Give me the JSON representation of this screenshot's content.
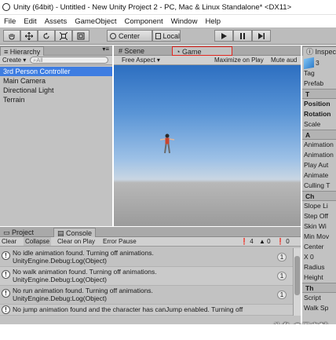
{
  "window": {
    "title": "Unity (64bit) - Untitled - New Unity Project 2 - PC, Mac & Linux Standalone* <DX11>"
  },
  "menu": {
    "items": [
      "File",
      "Edit",
      "Assets",
      "GameObject",
      "Component",
      "Window",
      "Help"
    ]
  },
  "toolbar": {
    "pivot_label": "Center",
    "space_label": "Local"
  },
  "hierarchy": {
    "tab_label": "Hierarchy",
    "create_label": "Create",
    "search_placeholder": "All",
    "items": [
      "3rd Person Controller",
      "Main Camera",
      "Directional Light",
      "Terrain"
    ]
  },
  "scene_view": {
    "scene_tab": "Scene",
    "game_tab": "Game",
    "aspect_label": "Free Aspect",
    "maximize_label": "Maximize on Play",
    "mute_label": "Mute aud"
  },
  "console": {
    "project_tab": "Project",
    "console_tab": "Console",
    "buttons": [
      "Clear",
      "Collapse",
      "Clear on Play",
      "Error Pause"
    ],
    "counts": {
      "warnings": "4",
      "errors": "0",
      "logs": "0"
    },
    "entries": [
      {
        "line1": "No idle animation found. Turning off animations.",
        "line2": "UnityEngine.Debug:Log(Object)",
        "count": "1"
      },
      {
        "line1": "No walk animation found. Turning off animations.",
        "line2": "UnityEngine.Debug:Log(Object)",
        "count": "1"
      },
      {
        "line1": "No run animation found. Turning off animations.",
        "line2": "UnityEngine.Debug:Log(Object)",
        "count": "1"
      },
      {
        "line1": "No jump animation found and the character has canJump enabled. Turning off",
        "line2": "",
        "count": ""
      }
    ]
  },
  "inspector": {
    "tab_label": "Inspec",
    "rows": [
      {
        "label": "3",
        "kind": "name"
      },
      {
        "label": "Tag",
        "kind": "field"
      },
      {
        "label": "Prefab",
        "kind": "field"
      },
      {
        "label": "T",
        "kind": "header"
      },
      {
        "label": "Position",
        "kind": "bold"
      },
      {
        "label": "Rotation",
        "kind": "bold"
      },
      {
        "label": "Scale",
        "kind": "field"
      },
      {
        "label": "A",
        "kind": "header"
      },
      {
        "label": "Animation",
        "kind": "field"
      },
      {
        "label": "Animation",
        "kind": "field"
      },
      {
        "label": "Play Aut",
        "kind": "field"
      },
      {
        "label": "Animate",
        "kind": "field"
      },
      {
        "label": "Culling T",
        "kind": "field"
      },
      {
        "label": "Ch",
        "kind": "header"
      },
      {
        "label": "Slope Li",
        "kind": "field"
      },
      {
        "label": "Step Off",
        "kind": "field"
      },
      {
        "label": "Skin Wi",
        "kind": "field"
      },
      {
        "label": "Min Mov",
        "kind": "field"
      },
      {
        "label": "Center",
        "kind": "field"
      },
      {
        "label": "X 0",
        "kind": "field"
      },
      {
        "label": "Radius",
        "kind": "field"
      },
      {
        "label": "Height",
        "kind": "field"
      },
      {
        "label": "Th",
        "kind": "header"
      },
      {
        "label": "Script",
        "kind": "field"
      },
      {
        "label": "Walk Sp",
        "kind": "field"
      }
    ]
  },
  "watermark": {
    "text": "头条 @王启越"
  },
  "colors": {
    "selection": "#3e7de1",
    "highlight_box": "#e0261f",
    "sky_top": "#2d6fc1",
    "ground": "#8d8d8d"
  }
}
